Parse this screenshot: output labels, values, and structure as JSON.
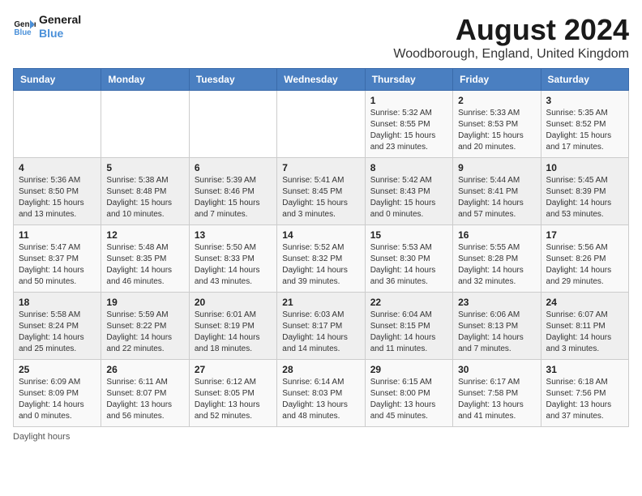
{
  "logo": {
    "line1": "General",
    "line2": "Blue"
  },
  "title": "August 2024",
  "location": "Woodborough, England, United Kingdom",
  "footer": "Daylight hours",
  "days_of_week": [
    "Sunday",
    "Monday",
    "Tuesday",
    "Wednesday",
    "Thursday",
    "Friday",
    "Saturday"
  ],
  "weeks": [
    [
      {
        "day": "",
        "info": ""
      },
      {
        "day": "",
        "info": ""
      },
      {
        "day": "",
        "info": ""
      },
      {
        "day": "",
        "info": ""
      },
      {
        "day": "1",
        "info": "Sunrise: 5:32 AM\nSunset: 8:55 PM\nDaylight: 15 hours\nand 23 minutes."
      },
      {
        "day": "2",
        "info": "Sunrise: 5:33 AM\nSunset: 8:53 PM\nDaylight: 15 hours\nand 20 minutes."
      },
      {
        "day": "3",
        "info": "Sunrise: 5:35 AM\nSunset: 8:52 PM\nDaylight: 15 hours\nand 17 minutes."
      }
    ],
    [
      {
        "day": "4",
        "info": "Sunrise: 5:36 AM\nSunset: 8:50 PM\nDaylight: 15 hours\nand 13 minutes."
      },
      {
        "day": "5",
        "info": "Sunrise: 5:38 AM\nSunset: 8:48 PM\nDaylight: 15 hours\nand 10 minutes."
      },
      {
        "day": "6",
        "info": "Sunrise: 5:39 AM\nSunset: 8:46 PM\nDaylight: 15 hours\nand 7 minutes."
      },
      {
        "day": "7",
        "info": "Sunrise: 5:41 AM\nSunset: 8:45 PM\nDaylight: 15 hours\nand 3 minutes."
      },
      {
        "day": "8",
        "info": "Sunrise: 5:42 AM\nSunset: 8:43 PM\nDaylight: 15 hours\nand 0 minutes."
      },
      {
        "day": "9",
        "info": "Sunrise: 5:44 AM\nSunset: 8:41 PM\nDaylight: 14 hours\nand 57 minutes."
      },
      {
        "day": "10",
        "info": "Sunrise: 5:45 AM\nSunset: 8:39 PM\nDaylight: 14 hours\nand 53 minutes."
      }
    ],
    [
      {
        "day": "11",
        "info": "Sunrise: 5:47 AM\nSunset: 8:37 PM\nDaylight: 14 hours\nand 50 minutes."
      },
      {
        "day": "12",
        "info": "Sunrise: 5:48 AM\nSunset: 8:35 PM\nDaylight: 14 hours\nand 46 minutes."
      },
      {
        "day": "13",
        "info": "Sunrise: 5:50 AM\nSunset: 8:33 PM\nDaylight: 14 hours\nand 43 minutes."
      },
      {
        "day": "14",
        "info": "Sunrise: 5:52 AM\nSunset: 8:32 PM\nDaylight: 14 hours\nand 39 minutes."
      },
      {
        "day": "15",
        "info": "Sunrise: 5:53 AM\nSunset: 8:30 PM\nDaylight: 14 hours\nand 36 minutes."
      },
      {
        "day": "16",
        "info": "Sunrise: 5:55 AM\nSunset: 8:28 PM\nDaylight: 14 hours\nand 32 minutes."
      },
      {
        "day": "17",
        "info": "Sunrise: 5:56 AM\nSunset: 8:26 PM\nDaylight: 14 hours\nand 29 minutes."
      }
    ],
    [
      {
        "day": "18",
        "info": "Sunrise: 5:58 AM\nSunset: 8:24 PM\nDaylight: 14 hours\nand 25 minutes."
      },
      {
        "day": "19",
        "info": "Sunrise: 5:59 AM\nSunset: 8:22 PM\nDaylight: 14 hours\nand 22 minutes."
      },
      {
        "day": "20",
        "info": "Sunrise: 6:01 AM\nSunset: 8:19 PM\nDaylight: 14 hours\nand 18 minutes."
      },
      {
        "day": "21",
        "info": "Sunrise: 6:03 AM\nSunset: 8:17 PM\nDaylight: 14 hours\nand 14 minutes."
      },
      {
        "day": "22",
        "info": "Sunrise: 6:04 AM\nSunset: 8:15 PM\nDaylight: 14 hours\nand 11 minutes."
      },
      {
        "day": "23",
        "info": "Sunrise: 6:06 AM\nSunset: 8:13 PM\nDaylight: 14 hours\nand 7 minutes."
      },
      {
        "day": "24",
        "info": "Sunrise: 6:07 AM\nSunset: 8:11 PM\nDaylight: 14 hours\nand 3 minutes."
      }
    ],
    [
      {
        "day": "25",
        "info": "Sunrise: 6:09 AM\nSunset: 8:09 PM\nDaylight: 14 hours\nand 0 minutes."
      },
      {
        "day": "26",
        "info": "Sunrise: 6:11 AM\nSunset: 8:07 PM\nDaylight: 13 hours\nand 56 minutes."
      },
      {
        "day": "27",
        "info": "Sunrise: 6:12 AM\nSunset: 8:05 PM\nDaylight: 13 hours\nand 52 minutes."
      },
      {
        "day": "28",
        "info": "Sunrise: 6:14 AM\nSunset: 8:03 PM\nDaylight: 13 hours\nand 48 minutes."
      },
      {
        "day": "29",
        "info": "Sunrise: 6:15 AM\nSunset: 8:00 PM\nDaylight: 13 hours\nand 45 minutes."
      },
      {
        "day": "30",
        "info": "Sunrise: 6:17 AM\nSunset: 7:58 PM\nDaylight: 13 hours\nand 41 minutes."
      },
      {
        "day": "31",
        "info": "Sunrise: 6:18 AM\nSunset: 7:56 PM\nDaylight: 13 hours\nand 37 minutes."
      }
    ]
  ]
}
